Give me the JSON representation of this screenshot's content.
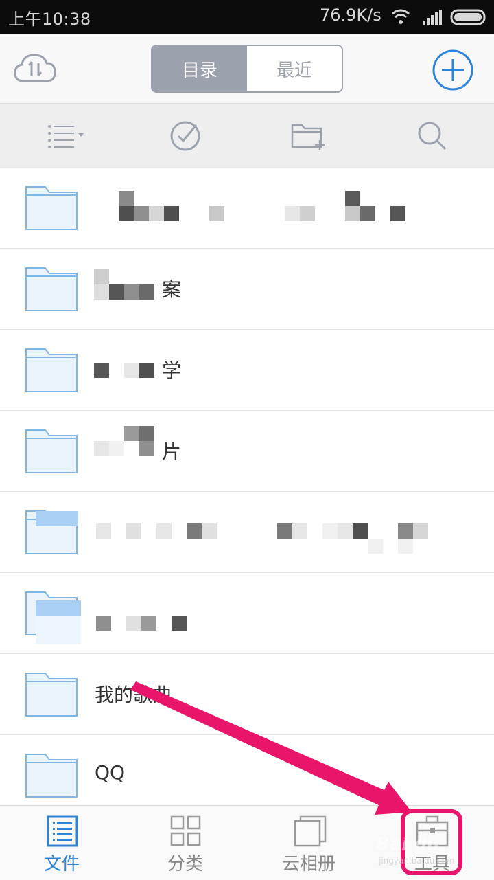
{
  "status_bar": {
    "time": "上午10:38",
    "network_speed": "76.9K/s",
    "icons": [
      "wifi-icon",
      "signal-icon",
      "battery-icon"
    ]
  },
  "header": {
    "tabs": [
      {
        "label": "目录",
        "active": true
      },
      {
        "label": "最近",
        "active": false
      }
    ],
    "cloud_icon": "cloud-transfer-icon",
    "add_icon": "add-circle-icon"
  },
  "toolbar": {
    "icons": [
      "list-view-icon",
      "select-check-icon",
      "new-folder-icon",
      "search-icon"
    ]
  },
  "files": [
    {
      "name": "",
      "redacted": true
    },
    {
      "name": "案",
      "redacted": true
    },
    {
      "name": "学",
      "redacted": true
    },
    {
      "name": "片",
      "redacted": true
    },
    {
      "name": "",
      "redacted": true
    },
    {
      "name": "",
      "redacted": true
    },
    {
      "name": "我的歌曲",
      "redacted": false
    },
    {
      "name": "QQ",
      "redacted": false
    }
  ],
  "bottom_nav": [
    {
      "label": "文件",
      "icon": "file-list-icon",
      "active": true
    },
    {
      "label": "分类",
      "icon": "category-grid-icon",
      "active": false
    },
    {
      "label": "云相册",
      "icon": "cloud-album-icon",
      "active": false
    },
    {
      "label": "工具",
      "icon": "toolbox-icon",
      "active": false
    }
  ],
  "colors": {
    "accent": "#2b84d8",
    "highlight": "#e8156b",
    "folder_fill": "#e9f4fd",
    "folder_stroke": "#7fb6e6"
  },
  "watermark": {
    "text": "Bai du",
    "sub": "jingyan.baidu.com"
  }
}
